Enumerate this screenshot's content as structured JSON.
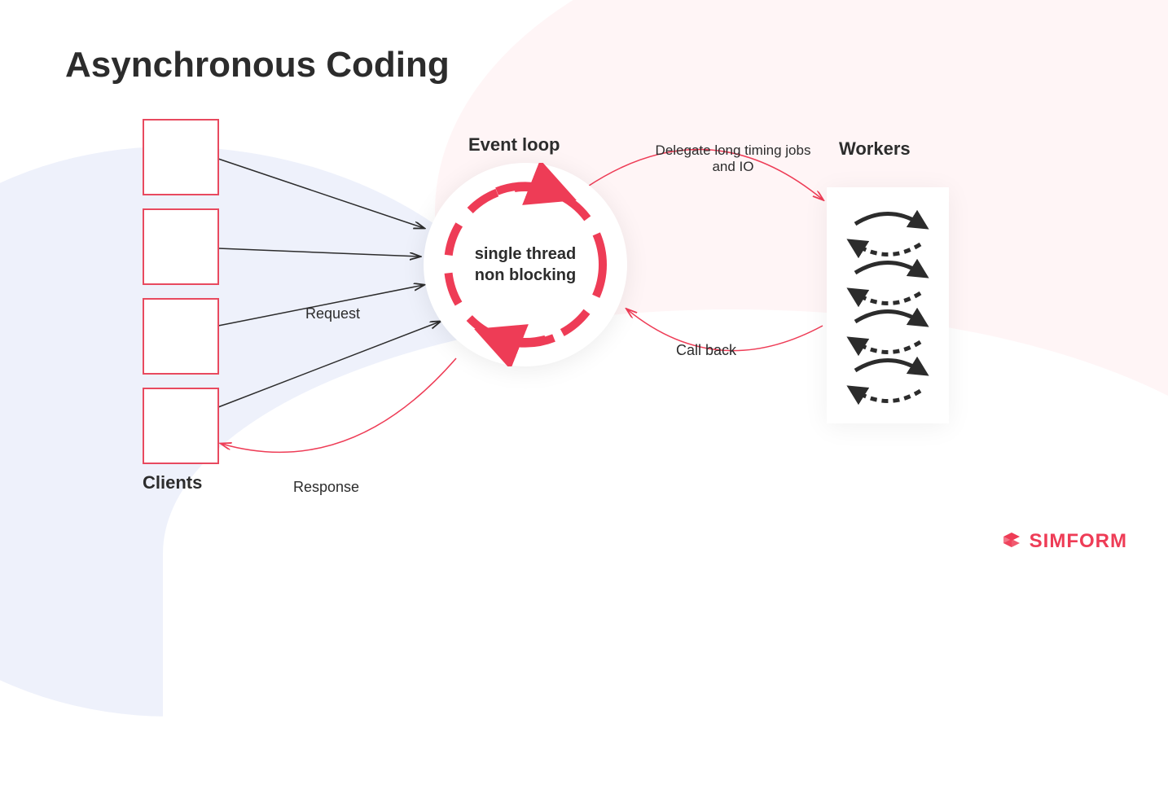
{
  "title": "Asynchronous Coding",
  "labels": {
    "event_loop": "Event loop",
    "workers": "Workers",
    "clients": "Clients",
    "request": "Request",
    "response": "Response",
    "delegate": "Delegate long timing jobs and IO",
    "callback": "Call back"
  },
  "event_loop_center": {
    "line1": "single thread",
    "line2": "non blocking"
  },
  "brand": "SIMFORM",
  "client_count": 4,
  "colors": {
    "accent": "#ee3c56",
    "dark": "#2c2c2c"
  }
}
